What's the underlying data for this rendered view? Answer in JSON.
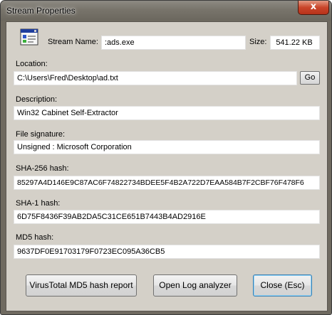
{
  "window": {
    "title": "Stream Properties",
    "close_glyph": "x"
  },
  "header": {
    "stream_name_label": "Stream Name:",
    "stream_name_value": ":ads.exe",
    "size_label": "Size:",
    "size_value": "541.22 KB",
    "icon": "application-window-icon"
  },
  "location": {
    "label": "Location:",
    "value": "C:\\Users\\Fred\\Desktop\\ad.txt",
    "go_label": "Go"
  },
  "description": {
    "label": "Description:",
    "value": "Win32 Cabinet Self-Extractor"
  },
  "signature": {
    "label": "File signature:",
    "value": "Unsigned :  Microsoft Corporation"
  },
  "sha256": {
    "label": "SHA-256 hash:",
    "value": "85297A4D146E9C87AC6F74822734BDEE5F4B2A722D7EAA584B7F2CBF76F478F6"
  },
  "sha1": {
    "label": "SHA-1 hash:",
    "value": "6D75F8436F39AB2DA5C31CE651B7443B4AD2916E"
  },
  "md5": {
    "label": "MD5 hash:",
    "value": "9637DF0E91703179F0723EC095A36CB5"
  },
  "buttons": {
    "virustotal": "VirusTotal MD5 hash report",
    "log_analyzer": "Open Log analyzer",
    "close": "Close (Esc)"
  }
}
